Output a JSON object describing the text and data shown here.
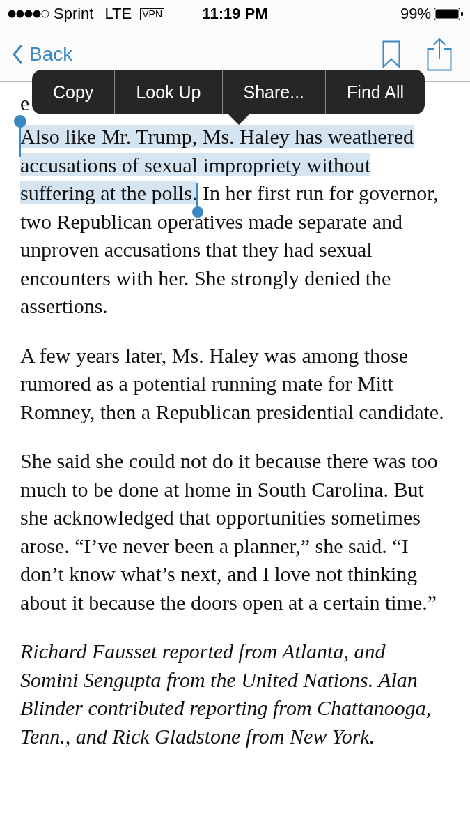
{
  "status_bar": {
    "carrier": "Sprint",
    "network": "LTE",
    "vpn": "VPN",
    "time": "11:19 PM",
    "battery": "99%"
  },
  "nav": {
    "back": "Back"
  },
  "edit_menu": {
    "items": [
      {
        "label": "Copy"
      },
      {
        "label": "Look Up"
      },
      {
        "label": "Share..."
      },
      {
        "label": "Find All"
      }
    ]
  },
  "article": {
    "covered_text": "e",
    "paragraphs": [
      {
        "kind": "body",
        "selected": "Also like Mr. Trump, Ms. Haley has weathered accusations of sexual impropriety without suffering at the polls.",
        "text": " In her first run for governor, two Republican operatives made separate and unproven accusations that they had sexual encounters with her. She strongly denied the assertions."
      },
      {
        "kind": "body",
        "text": "A few years later, Ms. Haley was among those rumored as a potential running mate for Mitt Romney, then a Republican presidential candidate."
      },
      {
        "kind": "body",
        "text": "She said she could not do it because there was too much to be done at home in South Carolina. But she acknowledged that opportunities sometimes arose. “I’ve never been a planner,” she said. “I don’t know what’s next, and I love not thinking about it because the doors open at a certain time.”"
      },
      {
        "kind": "byline",
        "text": "Richard Fausset reported from Atlanta, and Somini Sengupta from the United Nations. Alan Blinder contributed reporting from Chattanooga, Tenn., and Rick Gladstone from New York."
      }
    ]
  }
}
